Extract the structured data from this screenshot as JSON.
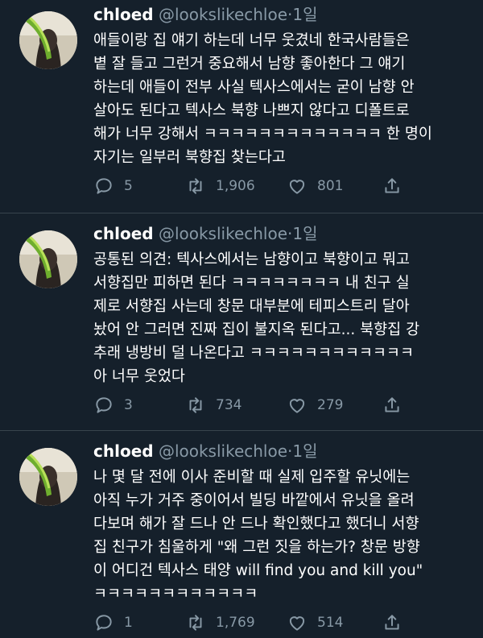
{
  "tweets": [
    {
      "name": "chloed",
      "handle": "@lookslikechloe",
      "dot": "·",
      "time": "1일",
      "lines": [
        "애들이랑 집 얘기 하는데 너무 웃겼네 한국사람들은",
        "볕 잘 들고 그런거 중요해서 남향 좋아한다 그 얘기",
        "하는데 애들이 전부 사실 텍사스에서는 굳이 남향 안",
        "살아도 된다고 텍사스 북향 나쁘지 않다고 디폴트로",
        "해가 너무 강해서 ㅋㅋㅋㅋㅋㅋㅋㅋㅋㅋㅋㅋㅋ 한 명이",
        "자기는 일부러 북향집 찾는다고"
      ],
      "replies": "5",
      "retweets": "1,906",
      "likes": "801"
    },
    {
      "name": "chloed",
      "handle": "@lookslikechloe",
      "dot": "·",
      "time": "1일",
      "lines": [
        "공통된 의견: 텍사스에서는 남향이고 북향이고 뭐고",
        "서향집만 피하면 된다 ㅋㅋㅋㅋㅋㅋㅋㅋ 내 친구 실",
        "제로 서향집 사는데 창문 대부분에 테피스트리 달아",
        "놨어 안 그러면 진짜 집이 불지옥 된다고... 북향집 강",
        "추래 냉방비 덜 나온다고 ㅋㅋㅋㅋㅋㅋㅋㅋㅋㅋㅋㅋ",
        "아 너무 웃었다"
      ],
      "replies": "3",
      "retweets": "734",
      "likes": "279"
    },
    {
      "name": "chloed",
      "handle": "@lookslikechloe",
      "dot": "·",
      "time": "1일",
      "lines": [
        "나 몇 달 전에 이사 준비할 때 실제 입주할 유닛에는",
        "아직 누가 거주 중이어서 빌딩 바깥에서 유닛을 올려",
        "다보며 해가 잘 드나 안 드나 확인했다고 했더니 서향",
        "집 친구가 침울하게 \"왜 그런 짓을 하는가? 창문 방향",
        "이 어디건 텍사스 태양 will find you and kill you\"",
        "ㅋㅋㅋㅋㅋㅋㅋㅋㅋㅋㅋㅋ"
      ],
      "replies": "1",
      "retweets": "1,769",
      "likes": "514"
    }
  ]
}
